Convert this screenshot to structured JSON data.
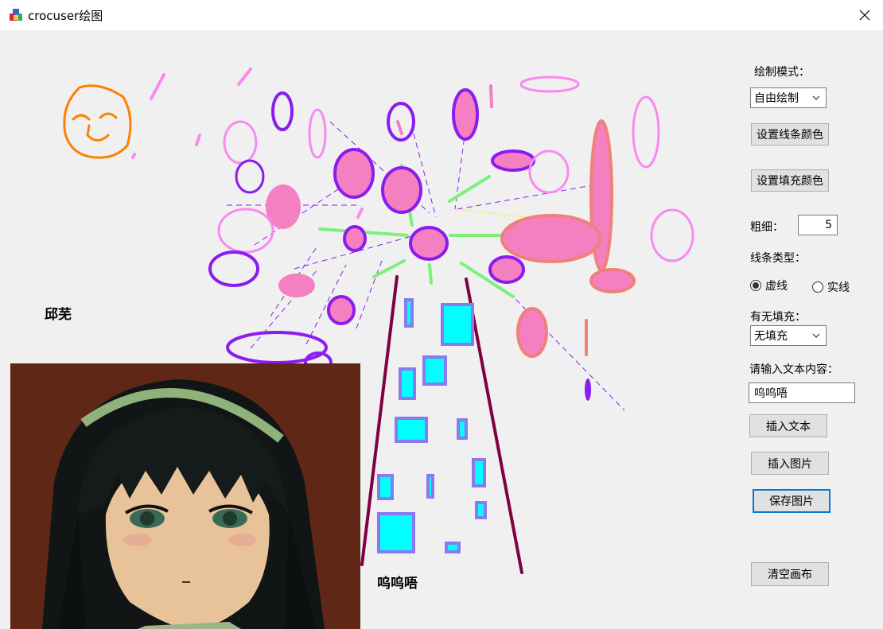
{
  "window": {
    "title": "crocuser绘图"
  },
  "canvas": {
    "text_items": [
      "邱芜",
      "呜呜唔"
    ]
  },
  "panel": {
    "draw_mode_label": "绘制模式：",
    "draw_mode_value": "自由绘制",
    "line_color_button": "设置线条颜色",
    "fill_color_button": "设置填充颜色",
    "thickness_label": "粗细：",
    "thickness_value": "5",
    "line_type_label": "线条类型：",
    "line_type_options": [
      "虚线",
      "实线"
    ],
    "line_type_selected": "虚线",
    "fill_label": "有无填充：",
    "fill_value": "无填充",
    "text_input_label": "请输入文本内容：",
    "text_input_value": "呜呜唔",
    "insert_text_button": "插入文本",
    "insert_image_button": "插入图片",
    "save_image_button": "保存图片",
    "clear_canvas_button": "清空画布"
  },
  "colors": {
    "purple": "#8a1cf0",
    "pink": "#f47fc1",
    "light_pink": "#f88af0",
    "salmon": "#f0807a",
    "green": "#7ef07a",
    "cyan": "#00ffff",
    "slate_blue": "#8a7af0",
    "maroon": "#800040",
    "orange": "#ff8000"
  }
}
